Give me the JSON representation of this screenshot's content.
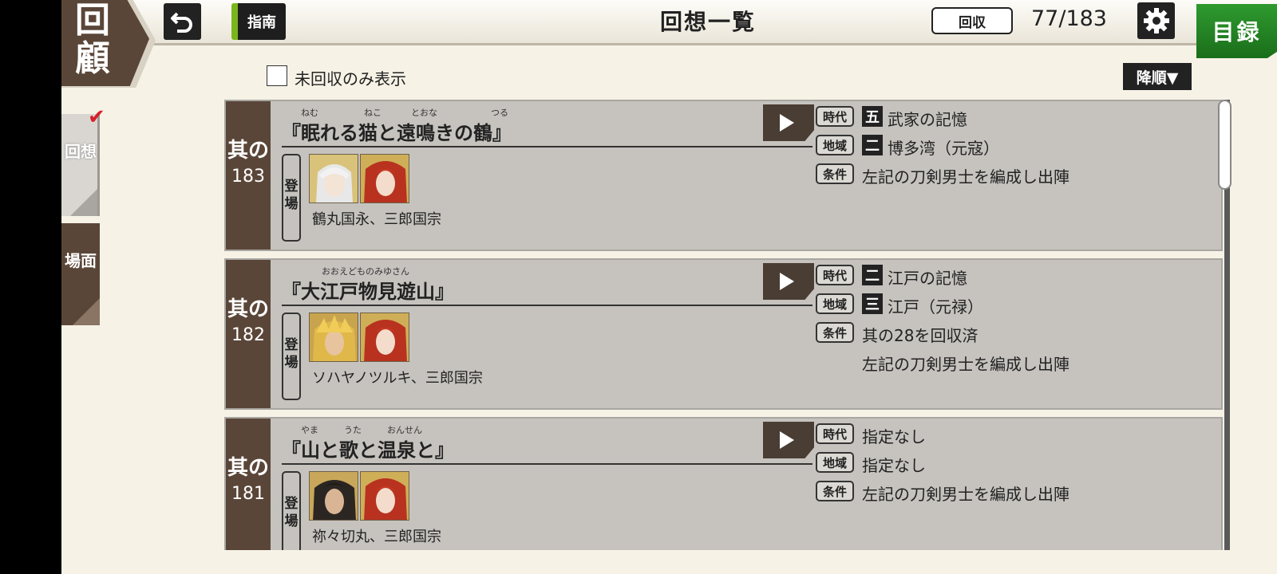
{
  "header": {
    "corner_title": "回顧",
    "guide_label": "指南",
    "title": "回想一覧",
    "collect_label": "回収",
    "count": "77/183",
    "catalog_label": "目録"
  },
  "side_tabs": [
    {
      "label": "回想",
      "selected": true
    },
    {
      "label": "場面",
      "selected": false
    }
  ],
  "filter": {
    "label": "未回収のみ表示",
    "checked": false
  },
  "sort": {
    "label": "降順▼"
  },
  "info_labels": {
    "era": "時代",
    "region": "地域",
    "condition": "条件"
  },
  "appear_label": "登場",
  "card_prefix": "其の",
  "cards": [
    {
      "number": "183",
      "title": "『眠れる猫と遠鳴きの鶴』",
      "ruby": [
        "ねむ",
        "ねこ",
        "とおな",
        "つる"
      ],
      "characters": "鶴丸国永、三郎国宗",
      "era_level": "五",
      "era": "武家の記憶",
      "region_level": "二",
      "region": "博多湾（元寇）",
      "conditions": [
        "左記の刀剣男士を編成し出陣"
      ]
    },
    {
      "number": "182",
      "title": "『大江戸物見遊山』",
      "ruby": [
        "おおえどものみゆさん"
      ],
      "characters": "ソハヤノツルキ、三郎国宗",
      "era_level": "二",
      "era": "江戸の記憶",
      "region_level": "三",
      "region": "江戸（元禄）",
      "conditions": [
        "其の28を回収済",
        "左記の刀剣男士を編成し出陣"
      ]
    },
    {
      "number": "181",
      "title": "『山と歌と温泉と』",
      "ruby": [
        "やま",
        "うた",
        "おんせん"
      ],
      "characters": "祢々切丸、三郎国宗",
      "era_level": "",
      "era": "指定なし",
      "region_level": "",
      "region": "指定なし",
      "conditions": [
        "左記の刀剣男士を編成し出陣"
      ]
    }
  ]
}
